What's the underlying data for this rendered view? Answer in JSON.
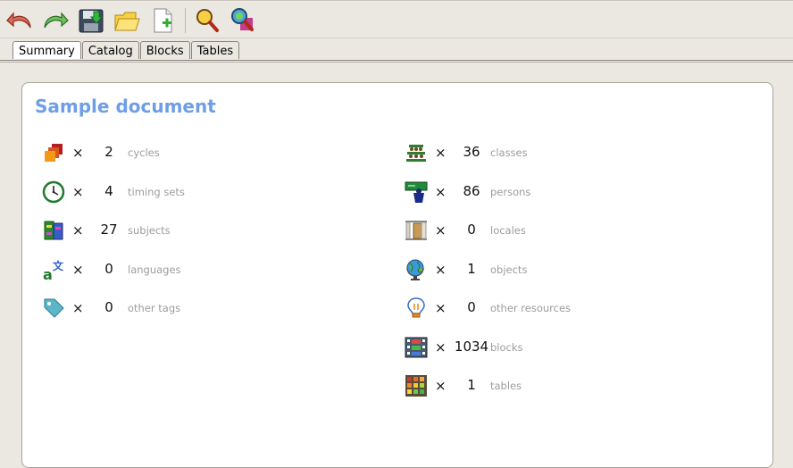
{
  "tabs": [
    "Summary",
    "Catalog",
    "Blocks",
    "Tables"
  ],
  "document": {
    "title": "Sample document"
  },
  "stats_left": [
    {
      "icon": "cycles-icon",
      "times": "×",
      "count": "2",
      "label": "cycles"
    },
    {
      "icon": "timing-clock-icon",
      "times": "×",
      "count": "4",
      "label": "timing sets"
    },
    {
      "icon": "subjects-books-icon",
      "times": "×",
      "count": "27",
      "label": "subjects"
    },
    {
      "icon": "languages-icon",
      "times": "×",
      "count": "0",
      "label": "languages"
    },
    {
      "icon": "tag-icon",
      "times": "×",
      "count": "0",
      "label": "other tags"
    }
  ],
  "stats_right": [
    {
      "icon": "classes-icon",
      "times": "×",
      "count": "36",
      "label": "classes"
    },
    {
      "icon": "persons-teacher-icon",
      "times": "×",
      "count": "86",
      "label": "persons"
    },
    {
      "icon": "locales-door-icon",
      "times": "×",
      "count": "0",
      "label": "locales"
    },
    {
      "icon": "globe-icon",
      "times": "×",
      "count": "1",
      "label": "objects"
    },
    {
      "icon": "lightbulb-icon",
      "times": "×",
      "count": "0",
      "label": "other resources"
    },
    {
      "icon": "blocks-film-icon",
      "times": "×",
      "count": "1034",
      "label": "blocks"
    },
    {
      "icon": "tables-grid-icon",
      "times": "×",
      "count": "1",
      "label": "tables"
    }
  ]
}
